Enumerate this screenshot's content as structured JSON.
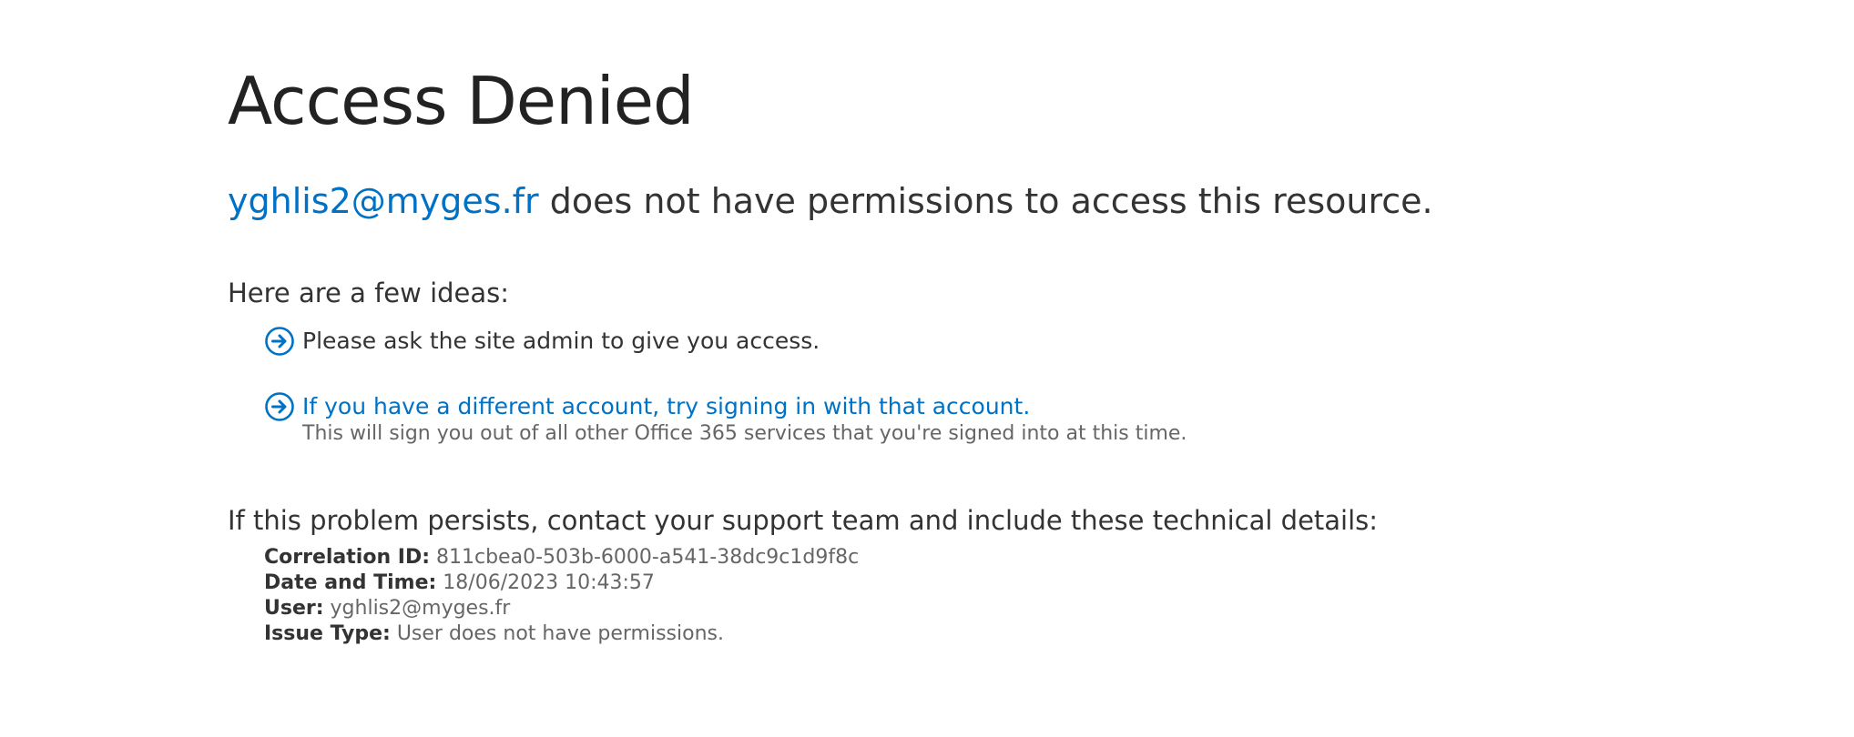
{
  "page": {
    "title": "Access Denied",
    "account": "yghlis2@myges.fr",
    "subtitle_rest": " does not have permissions to access this resource."
  },
  "ideas": {
    "heading": "Here are a few ideas:",
    "items": [
      {
        "text": "Please ask the site admin to give you access.",
        "icon": "arrow-circle-right-icon"
      },
      {
        "link": "If you have a different account, try signing in with that account.",
        "note": "This will sign you out of all other Office 365 services that you're signed into at this time.",
        "icon": "arrow-circle-right-icon"
      }
    ]
  },
  "support": {
    "text": "If this problem persists, contact your support team and include these technical details:"
  },
  "details": {
    "correlation_label": "Correlation ID:",
    "correlation_value": " 811cbea0-503b-6000-a541-38dc9c1d9f8c",
    "datetime_label": "Date and Time:",
    "datetime_value": " 18/06/2023 10:43:57",
    "user_label": "User:",
    "user_value": " yghlis2@myges.fr",
    "issue_label": "Issue Type:",
    "issue_value": " User does not have permissions."
  },
  "colors": {
    "link": "#0072c6",
    "text": "#333333",
    "muted": "#666666"
  }
}
